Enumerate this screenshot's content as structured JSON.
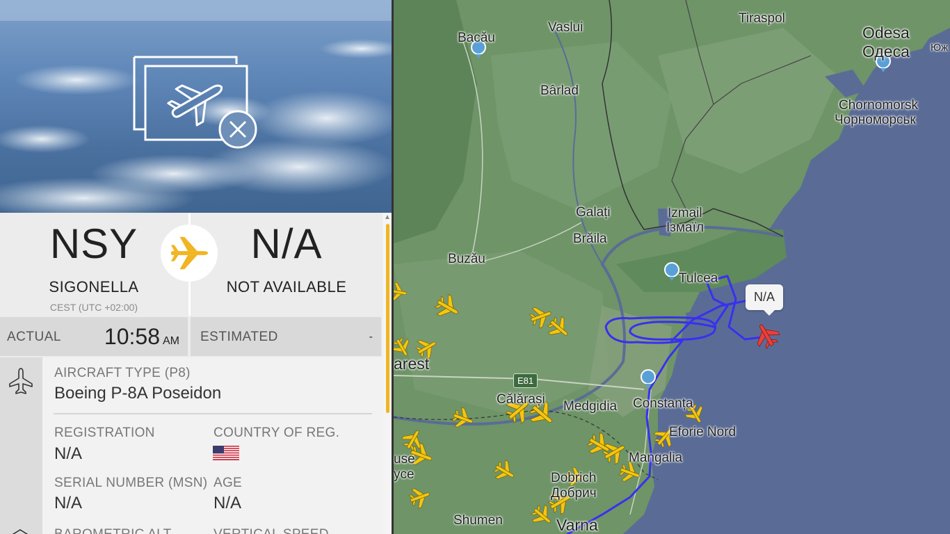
{
  "flight": {
    "origin": {
      "code": "NSY",
      "name": "SIGONELLA",
      "timezone": "CEST (UTC +02:00)"
    },
    "destination": {
      "code": "N/A",
      "name": "NOT AVAILABLE"
    },
    "times": {
      "actual_label": "ACTUAL",
      "actual_time": "10:58",
      "actual_ampm": "AM",
      "estimated_label": "ESTIMATED",
      "estimated_value": "-"
    }
  },
  "aircraft": {
    "type_label": "AIRCRAFT TYPE (P8)",
    "type_value": "Boeing P-8A Poseidon",
    "registration_label": "REGISTRATION",
    "registration_value": "N/A",
    "country_label": "COUNTRY OF REG.",
    "country_flag": "us-flag",
    "serial_label": "SERIAL NUMBER (MSN)",
    "serial_value": "N/A",
    "age_label": "AGE",
    "age_value": "N/A",
    "baro_label": "BAROMETRIC ALT.",
    "vspeed_label": "VERTICAL SPEED"
  },
  "map": {
    "selected_label": "N/A",
    "road_shield": "E81",
    "places": [
      "Bacău",
      "Vaslui",
      "Tiraspol",
      "Odesa",
      "Одеса",
      "Юж",
      "Bârlad",
      "Chornomorsk",
      "Чорноморськ",
      "Galați",
      "Izmail",
      "Ізмаїл",
      "Brăila",
      "Buzău",
      "Tulcea",
      "arest",
      "Călărași",
      "Medgidia",
      "Constanța",
      "Eforie Nord",
      "Mangalia",
      "Dobrich",
      "Добрич",
      "use",
      "yce",
      "Shumen",
      "Varna"
    ]
  },
  "colors": {
    "accent": "#f0b521",
    "track": "#3a2ff0",
    "selected_aircraft": "#e8413d",
    "sea": "#5a6c96",
    "land": "#6e9468"
  }
}
